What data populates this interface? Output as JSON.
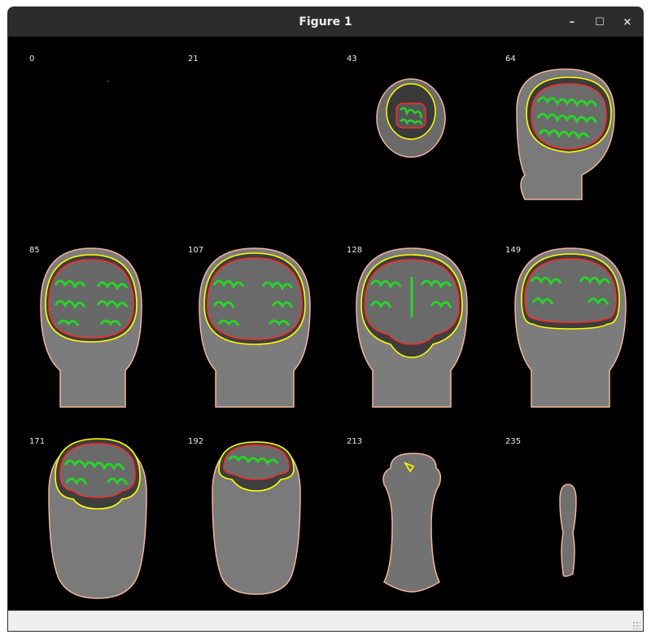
{
  "window": {
    "title": "Figure 1",
    "controls": {
      "minimize": "–",
      "maximize": "☐",
      "close": "×"
    }
  },
  "figure": {
    "panels": [
      {
        "label": "0"
      },
      {
        "label": "21"
      },
      {
        "label": "43"
      },
      {
        "label": "64"
      },
      {
        "label": "85"
      },
      {
        "label": "107"
      },
      {
        "label": "128"
      },
      {
        "label": "149"
      },
      {
        "label": "171"
      },
      {
        "label": "192"
      },
      {
        "label": "213"
      },
      {
        "label": "235"
      }
    ],
    "colors": {
      "background": "#000000",
      "skin_contour": "#f3b69a",
      "outer_skull_contour": "#ffff00",
      "inner_skull_contour": "#ff2a2a",
      "brain_surface": "#28d428"
    }
  }
}
